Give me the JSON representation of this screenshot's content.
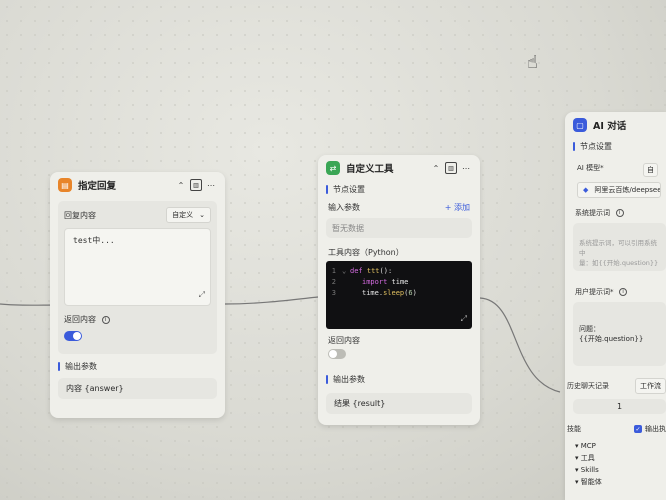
{
  "reply_node": {
    "title": "指定回复",
    "content_label": "回复内容",
    "mode_select": "自定义",
    "text_value": "test中...",
    "return_label": "返回内容",
    "output_label": "输出参数",
    "output_value": "内容 {answer}",
    "accent": "#e8852a"
  },
  "tool_node": {
    "title": "自定义工具",
    "node_settings": "节点设置",
    "input_label": "输入参数",
    "add_label": "+ 添加",
    "empty_text": "暂无数据",
    "code_label": "工具内容（Python）",
    "code_lines": [
      {
        "n": "1",
        "text": "def ttt():"
      },
      {
        "n": "2",
        "text": "import time"
      },
      {
        "n": "3",
        "text": "time.sleep(6)"
      }
    ],
    "return_label": "返回内容",
    "output_label": "输出参数",
    "output_value": "结果 {result}",
    "accent": "#3aa655"
  },
  "ai_node": {
    "title": "AI 对话",
    "node_settings": "节点设置",
    "model_label": "AI 模型*",
    "model_value": "阿里云百炼/deepsee",
    "model_side": "自",
    "sys_prompt_label": "系统提示词",
    "sys_prompt_placeholder": "系统提示词，可以引用系统中\n量：如{{开始.question}}",
    "user_prompt_label": "用户提示词*",
    "user_prompt_value": "问题：\n{{开始.question}}",
    "history_label": "历史聊天记录",
    "history_select": "工作流",
    "history_value": "1",
    "skills_label": "技能",
    "output_check_label": "输出执",
    "skills": [
      "MCP",
      "工具",
      "Skills",
      "智能体"
    ],
    "accent": "#3b5bdb"
  }
}
